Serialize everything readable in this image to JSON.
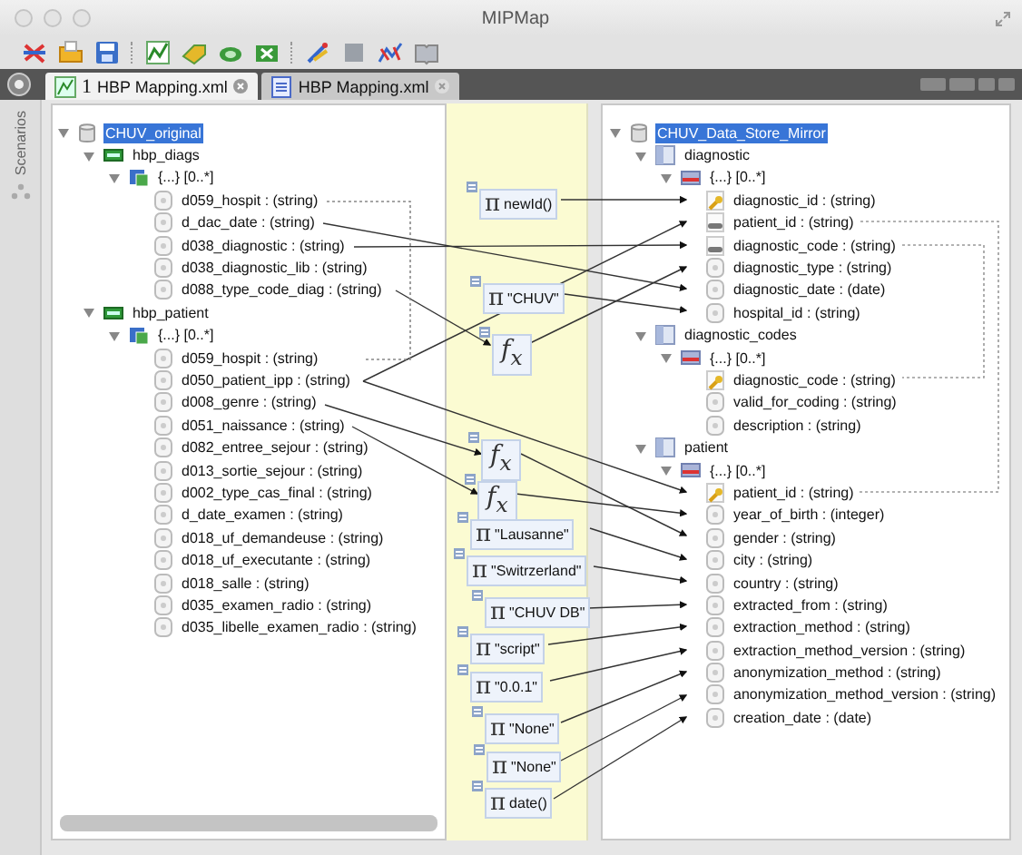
{
  "window": {
    "title": "MIPMap"
  },
  "tabs": [
    {
      "number": "1",
      "label": "HBP Mapping.xml",
      "selected": true,
      "kind": "mapping"
    },
    {
      "label": "HBP Mapping.xml",
      "selected": false,
      "kind": "document"
    }
  ],
  "side_panel": {
    "label": "Scenarios"
  },
  "source_tree": [
    {
      "kind": "database",
      "label": "CHUV_original",
      "selected": true,
      "expanded": true,
      "children": [
        {
          "kind": "table",
          "label": "hbp_diags",
          "expanded": true,
          "children": [
            {
              "kind": "set",
              "label": "{...} [0..*]",
              "expanded": true,
              "children": [
                {
                  "kind": "field",
                  "label": "d059_hospit : (string)"
                },
                {
                  "kind": "field",
                  "label": "d_dac_date : (string)"
                },
                {
                  "kind": "field",
                  "label": "d038_diagnostic : (string)"
                },
                {
                  "kind": "field",
                  "label": "d038_diagnostic_lib : (string)"
                },
                {
                  "kind": "field",
                  "label": "d088_type_code_diag : (string)"
                }
              ]
            }
          ]
        },
        {
          "kind": "table",
          "label": "hbp_patient",
          "expanded": true,
          "children": [
            {
              "kind": "set",
              "label": "{...} [0..*]",
              "expanded": true,
              "children": [
                {
                  "kind": "field",
                  "label": "d059_hospit : (string)"
                },
                {
                  "kind": "field",
                  "label": "d050_patient_ipp : (string)"
                },
                {
                  "kind": "field",
                  "label": "d008_genre : (string)"
                },
                {
                  "kind": "field",
                  "label": "d051_naissance : (string)"
                },
                {
                  "kind": "field",
                  "label": "d082_entree_sejour : (string)"
                },
                {
                  "kind": "field",
                  "label": "d013_sortie_sejour : (string)"
                },
                {
                  "kind": "field",
                  "label": "d002_type_cas_final : (string)"
                },
                {
                  "kind": "field",
                  "label": "d_date_examen : (string)"
                },
                {
                  "kind": "field",
                  "label": "d018_uf_demandeuse : (string)"
                },
                {
                  "kind": "field",
                  "label": "d018_uf_executante : (string)"
                },
                {
                  "kind": "field",
                  "label": "d018_salle : (string)"
                },
                {
                  "kind": "field",
                  "label": "d035_examen_radio : (string)"
                },
                {
                  "kind": "field",
                  "label": "d035_libelle_examen_radio : (string)"
                }
              ]
            }
          ]
        }
      ]
    }
  ],
  "target_tree": [
    {
      "kind": "database",
      "label": "CHUV_Data_Store_Mirror",
      "selected": true,
      "expanded": true,
      "children": [
        {
          "kind": "table",
          "label": "diagnostic",
          "expanded": true,
          "children": [
            {
              "kind": "set",
              "label": "{...} [0..*]",
              "expanded": true,
              "children": [
                {
                  "kind": "key",
                  "label": "diagnostic_id : (string)"
                },
                {
                  "kind": "link",
                  "label": "patient_id : (string)"
                },
                {
                  "kind": "link",
                  "label": "diagnostic_code : (string)"
                },
                {
                  "kind": "field",
                  "label": "diagnostic_type : (string)"
                },
                {
                  "kind": "field",
                  "label": "diagnostic_date : (date)"
                },
                {
                  "kind": "field",
                  "label": "hospital_id : (string)"
                }
              ]
            }
          ]
        },
        {
          "kind": "table",
          "label": "diagnostic_codes",
          "expanded": true,
          "children": [
            {
              "kind": "set",
              "label": "{...} [0..*]",
              "expanded": true,
              "children": [
                {
                  "kind": "key",
                  "label": "diagnostic_code : (string)"
                },
                {
                  "kind": "field",
                  "label": "valid_for_coding : (string)"
                },
                {
                  "kind": "field",
                  "label": "description : (string)"
                }
              ]
            }
          ]
        },
        {
          "kind": "table",
          "label": "patient",
          "expanded": true,
          "children": [
            {
              "kind": "set",
              "label": "{...} [0..*]",
              "expanded": true,
              "children": [
                {
                  "kind": "key",
                  "label": "patient_id : (string)"
                },
                {
                  "kind": "field",
                  "label": "year_of_birth : (integer)"
                },
                {
                  "kind": "field",
                  "label": "gender : (string)"
                },
                {
                  "kind": "field",
                  "label": "city : (string)"
                },
                {
                  "kind": "field",
                  "label": "country : (string)"
                },
                {
                  "kind": "field",
                  "label": "extracted_from : (string)"
                },
                {
                  "kind": "field",
                  "label": "extraction_method : (string)"
                },
                {
                  "kind": "field",
                  "label": "extraction_method_version : (string)"
                },
                {
                  "kind": "field",
                  "label": "anonymization_method : (string)"
                },
                {
                  "kind": "field",
                  "label": "anonymization_method_version : (string)"
                },
                {
                  "kind": "field",
                  "label": "creation_date : (date)"
                }
              ]
            }
          ]
        }
      ]
    }
  ],
  "nodes": [
    {
      "kind": "constant",
      "symbol": "π",
      "label": "newId()"
    },
    {
      "kind": "constant",
      "symbol": "π",
      "label": "\"CHUV\""
    },
    {
      "kind": "function",
      "symbol": "f$_{x}$"
    },
    {
      "kind": "function",
      "symbol": "f$_{x}$"
    },
    {
      "kind": "function",
      "symbol": "f$_{x}$"
    },
    {
      "kind": "constant",
      "symbol": "π",
      "label": "\"Lausanne\""
    },
    {
      "kind": "constant",
      "symbol": "π",
      "label": "\"Switrzerland\""
    },
    {
      "kind": "constant",
      "symbol": "π",
      "label": "\"CHUV DB\""
    },
    {
      "kind": "constant",
      "symbol": "π",
      "label": "\"script\""
    },
    {
      "kind": "constant",
      "symbol": "π",
      "label": "\"0.0.1\""
    },
    {
      "kind": "constant",
      "symbol": "π",
      "label": "\"None\""
    },
    {
      "kind": "constant",
      "symbol": "π",
      "label": "\"None\""
    },
    {
      "kind": "constant",
      "symbol": "π",
      "label": "date()"
    }
  ]
}
